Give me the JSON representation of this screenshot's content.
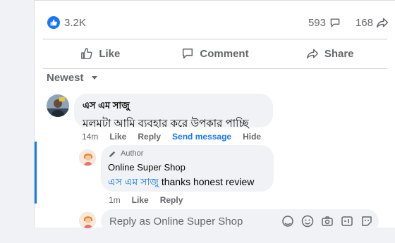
{
  "counts": {
    "likes": "3.2K",
    "comments": "593",
    "shares": "168"
  },
  "actions": {
    "like": "Like",
    "comment": "Comment",
    "share": "Share"
  },
  "sort": {
    "label": "Newest"
  },
  "comment": {
    "author": "এস এম সাজু",
    "text": "মলমটা আমি ব্যবহার করে উপকার পাচ্ছি",
    "time": "14m",
    "like": "Like",
    "reply": "Reply",
    "send_message": "Send message",
    "hide": "Hide"
  },
  "reply_comment": {
    "badge": "Author",
    "author": "Online Super Shop",
    "mention": "এস এম সাজু",
    "text": "thanks honest review",
    "time": "1m",
    "like": "Like",
    "reply": "Reply"
  },
  "reply_box": {
    "placeholder": "Reply as Online Super Shop"
  },
  "colors": {
    "accent": "#1877f2",
    "bubble": "#f0f2f5",
    "muted": "#65676b"
  },
  "icons": [
    "like-badge-icon",
    "comment-count-icon",
    "share-count-icon",
    "thumb-up-icon",
    "comment-icon",
    "share-icon",
    "dropdown-caret-icon",
    "pencil-icon",
    "avatar-sticker-icon",
    "emoji-icon",
    "camera-icon",
    "gif-icon",
    "sticker-icon"
  ]
}
